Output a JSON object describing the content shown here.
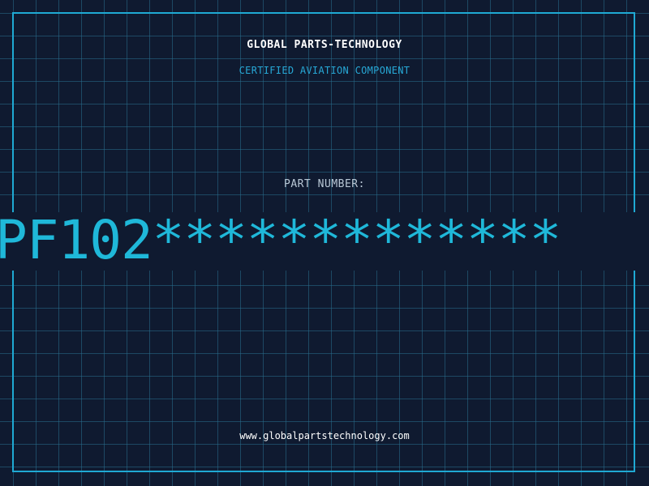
{
  "header": {
    "company": "GLOBAL PARTS-TECHNOLOGY",
    "tagline": "CERTIFIED AVIATION COMPONENT"
  },
  "part": {
    "label": "PART NUMBER:",
    "value": "PF102*************"
  },
  "footer": {
    "website": "www.globalpartstechnology.com"
  },
  "colors": {
    "background": "#0f1a30",
    "grid": "#286e8c",
    "accent": "#1fa9d3",
    "text": "#ffffff"
  }
}
